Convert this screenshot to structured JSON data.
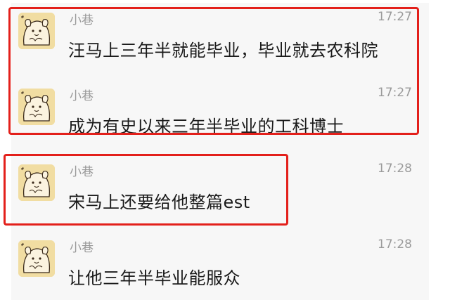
{
  "messages": [
    {
      "sender": "小巷",
      "time": "17:27",
      "text": "汪马上三年半就能毕业，毕业就去农科院"
    },
    {
      "sender": "小巷",
      "time": "17:27",
      "text": "成为有史以来三年半毕业的工科博士"
    },
    {
      "sender": "小巷",
      "time": "17:28",
      "text": "宋马上还要给他整篇est"
    },
    {
      "sender": "小巷",
      "time": "17:28",
      "text": "让他三年半毕业能服众"
    }
  ],
  "avatar_icon": "cartoon-dog-avatar-icon",
  "colors": {
    "highlight_border": "#e3201b",
    "avatar_bg": "#f1dda2",
    "message_bg": "#f7f7f7",
    "meta_text": "#9a9a9a",
    "body_text": "#1a1a1a"
  }
}
